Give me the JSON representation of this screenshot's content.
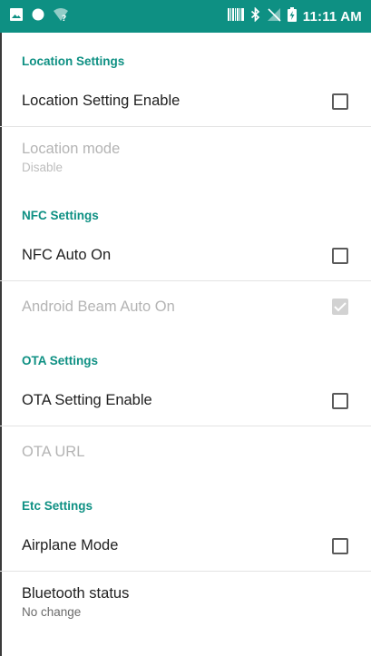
{
  "status_bar": {
    "time": "11:11 AM",
    "icons": [
      "image-icon",
      "circle-icon",
      "wifi-question-icon",
      "barcode-icon",
      "bluetooth-icon",
      "no-signal-icon",
      "battery-charging-icon"
    ],
    "background_color": "#0e9083"
  },
  "sections": {
    "location": {
      "header": "Location Settings",
      "enable": {
        "title": "Location Setting Enable",
        "checked": false
      },
      "mode": {
        "title": "Location mode",
        "summary": "Disable",
        "enabled": false
      }
    },
    "nfc": {
      "header": "NFC Settings",
      "auto_on": {
        "title": "NFC Auto On",
        "checked": false
      },
      "beam": {
        "title": "Android Beam Auto On",
        "checked": true,
        "enabled": false
      }
    },
    "ota": {
      "header": "OTA Settings",
      "enable": {
        "title": "OTA Setting Enable",
        "checked": false
      },
      "url": {
        "title": "OTA URL",
        "enabled": false
      }
    },
    "etc": {
      "header": "Etc Settings",
      "airplane": {
        "title": "Airplane Mode",
        "checked": false
      },
      "bluetooth": {
        "title": "Bluetooth status",
        "summary": "No change"
      }
    }
  },
  "colors": {
    "accent": "#0e9083",
    "text_primary": "#212121",
    "text_disabled": "#b4b4b4",
    "divider": "#e3e3e3"
  }
}
